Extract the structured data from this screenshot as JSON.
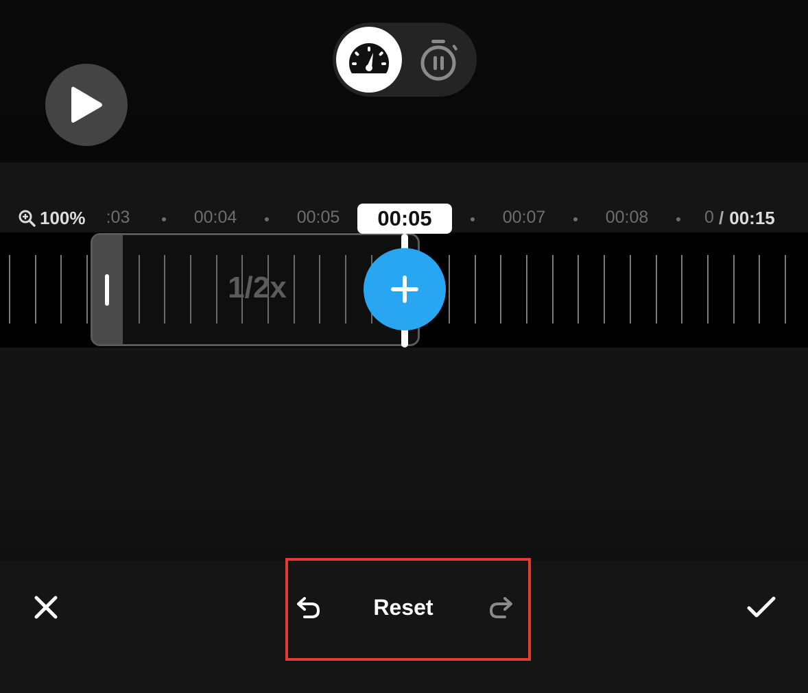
{
  "player": {
    "play_icon": "play-icon"
  },
  "mode_toggle": {
    "options": [
      {
        "name": "speed",
        "icon": "speedometer-icon",
        "selected": true
      },
      {
        "name": "freeze",
        "icon": "stopwatch-pause-icon",
        "selected": false
      }
    ]
  },
  "timeline": {
    "zoom_label": "100%",
    "ticks": [
      ":03",
      "00:04",
      "00:05",
      "00:07",
      "00:08",
      "0"
    ],
    "playhead_time": "00:05",
    "total_duration": "00:15",
    "duration_separator": "/"
  },
  "segment": {
    "speed_label": "1/2x"
  },
  "toolbar": {
    "reset_label": "Reset",
    "redo_enabled": false,
    "highlight_color": "#e53935"
  },
  "colors": {
    "accent": "#29a6f2",
    "background": "#151515"
  }
}
